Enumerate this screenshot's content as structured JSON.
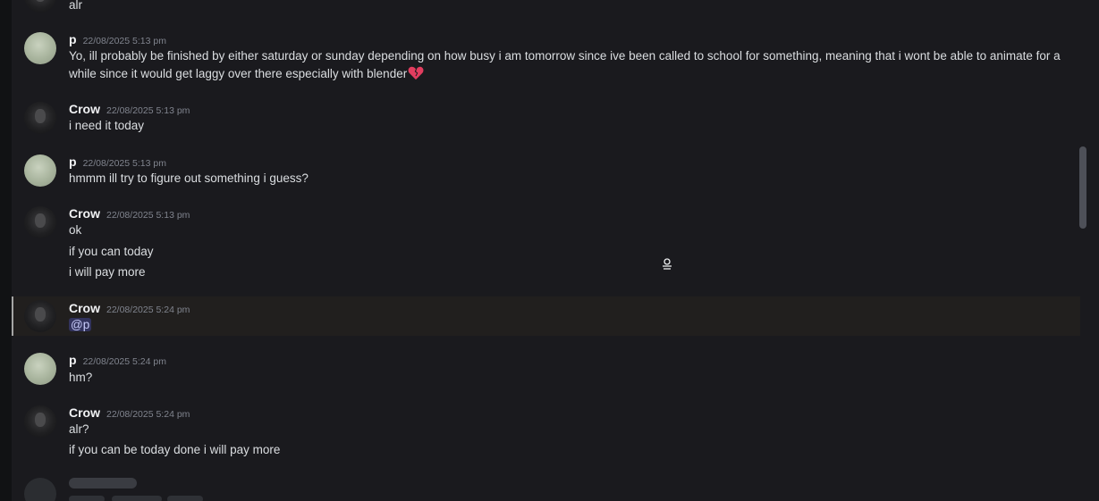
{
  "messages": {
    "prev_tail": "alr",
    "m1": {
      "author": "p",
      "time": "22/08/2025 5:13 pm",
      "text": "Yo, ill probably be finished by either saturday or sunday depending on how busy i am tomorrow since ive been called to school for something, meaning that i wont be able to animate for a while since it would get laggy over there especially with blender",
      "emoji": "broken-heart-icon"
    },
    "m2": {
      "author": "Crow",
      "time": "22/08/2025 5:13 pm",
      "text": "i need it today"
    },
    "m3": {
      "author": "p",
      "time": "22/08/2025 5:13 pm",
      "text": "hmmm ill try to figure out something i guess?"
    },
    "m4": {
      "author": "Crow",
      "time": "22/08/2025 5:13 pm",
      "lines": [
        "ok",
        "if you can today",
        "i will pay more"
      ]
    },
    "m5": {
      "author": "Crow",
      "time": "22/08/2025 5:24 pm",
      "mention": "@p"
    },
    "m6": {
      "author": "p",
      "time": "22/08/2025 5:24 pm",
      "text": "hm?"
    },
    "m7": {
      "author": "Crow",
      "time": "22/08/2025 5:24 pm",
      "lines": [
        "alr?",
        "if you can be today done i will pay more"
      ]
    }
  },
  "colors": {
    "background": "#1a1a1e",
    "mention_highlight_border": "#a5a5a5",
    "mention_pill": "#5865f2"
  }
}
